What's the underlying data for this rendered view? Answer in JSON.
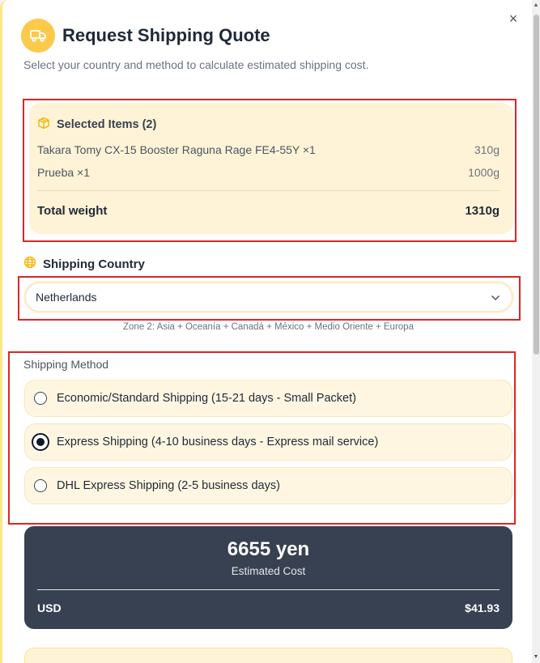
{
  "modal": {
    "title": "Request Shipping Quote",
    "subtitle": "Select your country and method to calculate estimated shipping cost.",
    "close_label": "×",
    "header_icon": "truck-icon"
  },
  "items": {
    "heading": "Selected Items (2)",
    "icon": "package-icon",
    "list": [
      {
        "name": "Takara Tomy CX-15 Booster Raguna Rage FE4-55Y ×1",
        "weight": "310g"
      },
      {
        "name": "Prueba ×1",
        "weight": "1000g"
      }
    ],
    "total_label": "Total weight",
    "total_value": "1310g"
  },
  "country": {
    "label": "Shipping Country",
    "icon": "globe-icon",
    "selected": "Netherlands",
    "zone_note": "Zone 2: Asia + Oceanía + Canadá + México + Medio Oriente + Europa"
  },
  "method": {
    "label": "Shipping Method",
    "options": [
      {
        "label": "Economic/Standard Shipping (15-21 days - Small Packet)",
        "checked": false
      },
      {
        "label": "Express Shipping (4-10 business days - Express mail service)",
        "checked": true
      },
      {
        "label": "DHL Express Shipping (2-5 business days)",
        "checked": false
      }
    ]
  },
  "cost": {
    "amount": "6655 yen",
    "caption": "Estimated Cost",
    "usd_label": "USD",
    "usd_value": "$41.93"
  },
  "colors": {
    "accent": "#fcc94a",
    "card_bg": "#fef3d6",
    "cost_bg": "#374151",
    "highlight": "#dc2626"
  }
}
